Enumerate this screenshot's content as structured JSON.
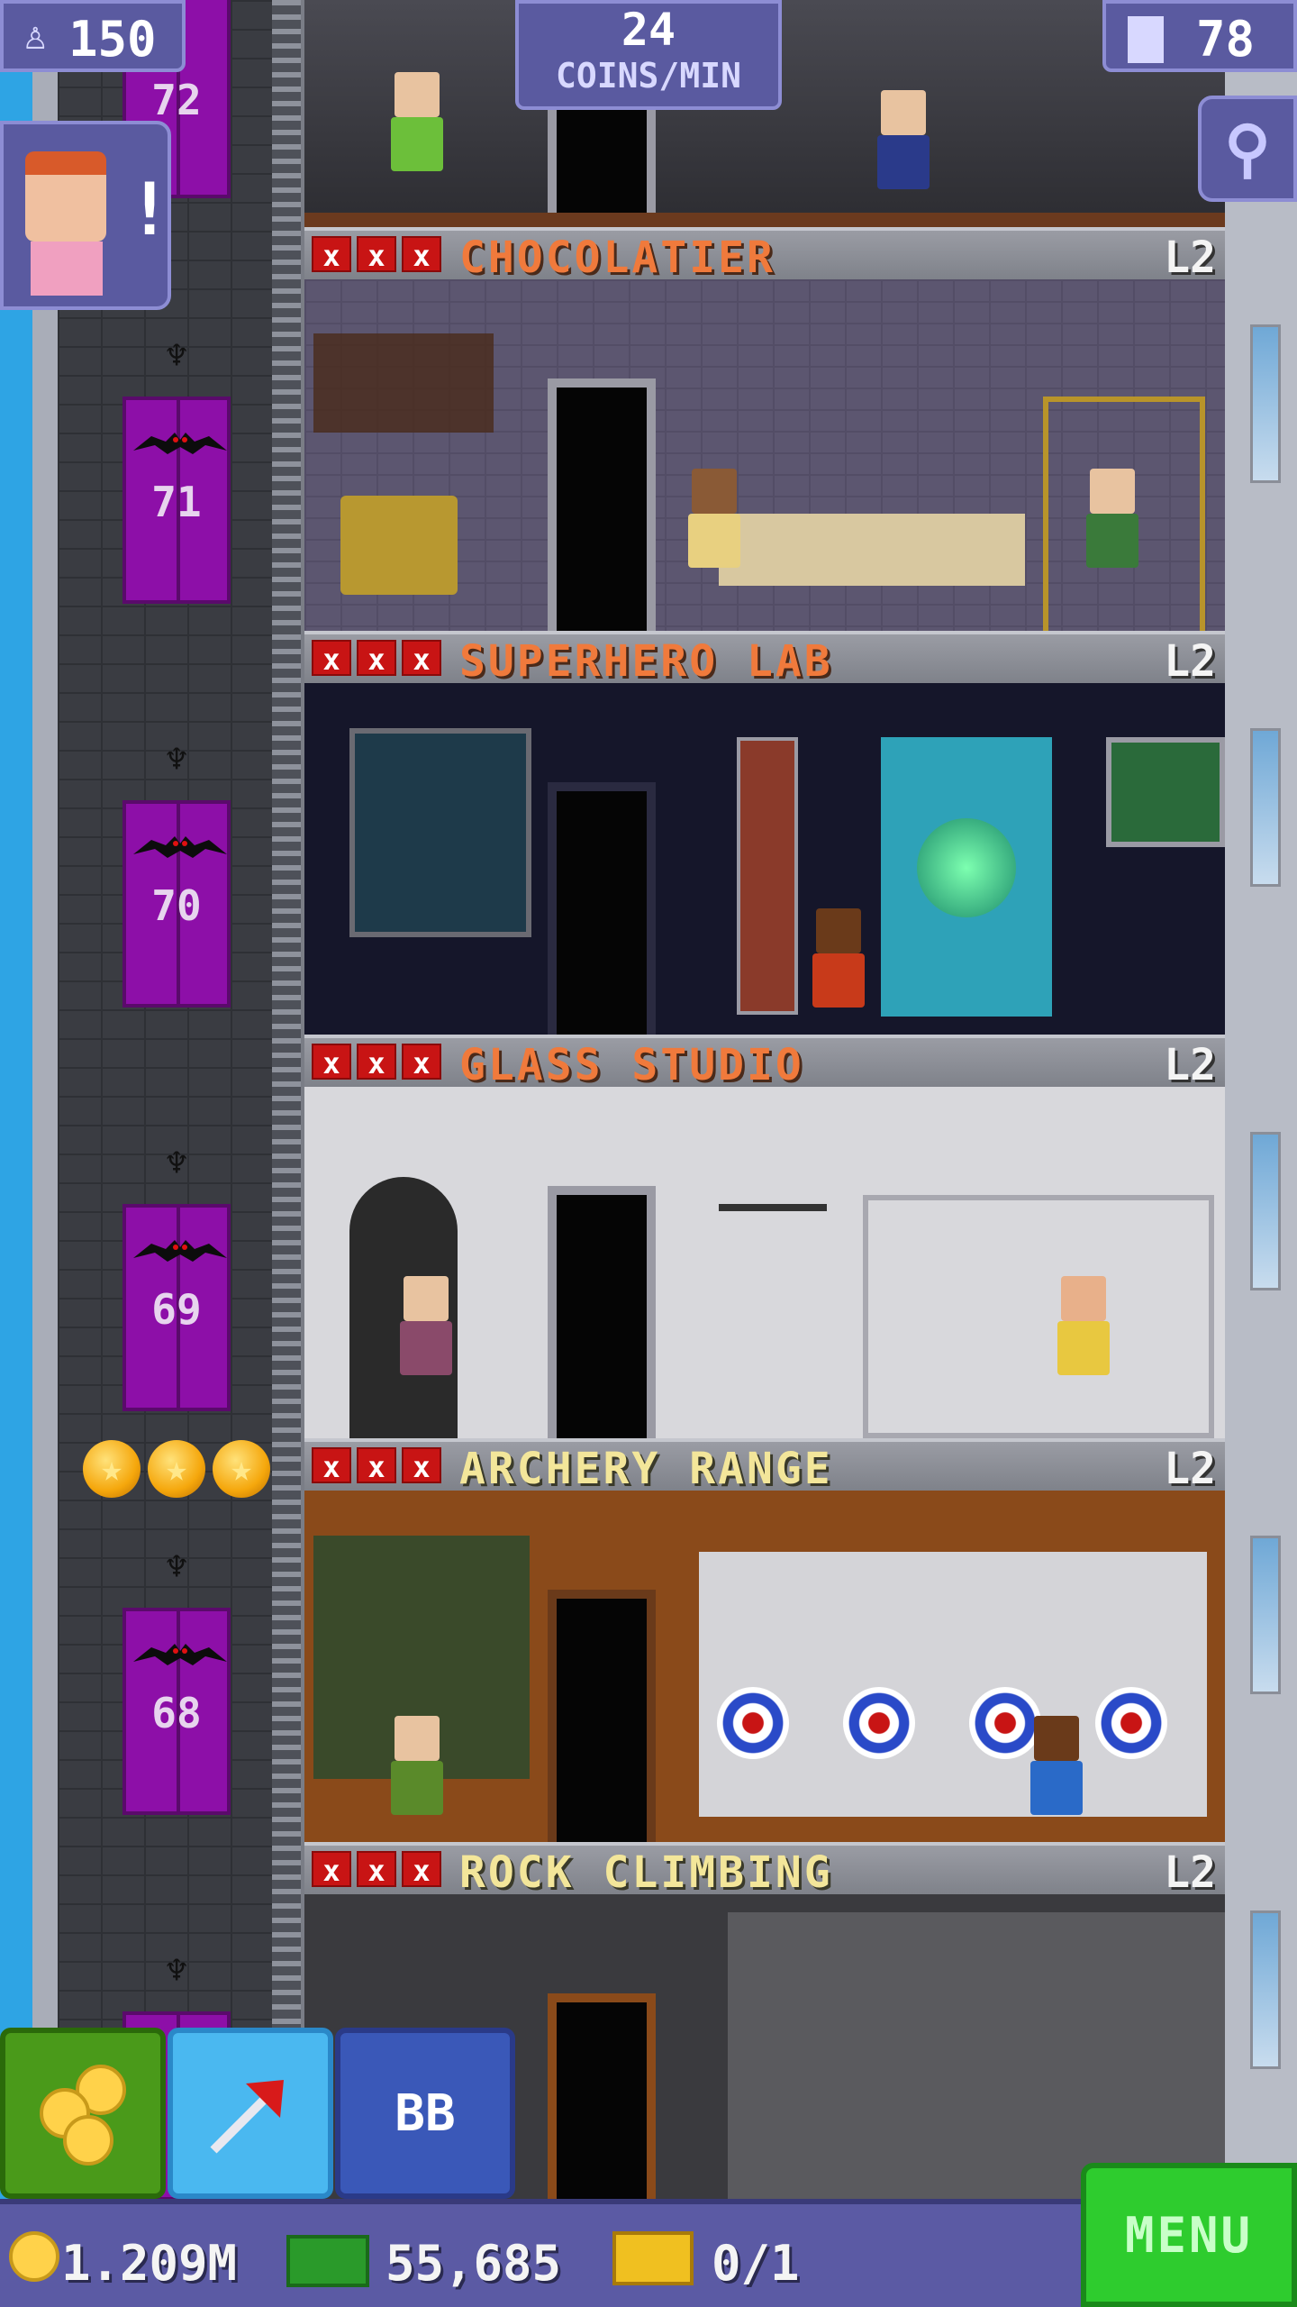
{
  "hud": {
    "population": "150",
    "coins_rate_value": "24",
    "coins_rate_unit": "COINS/MIN",
    "floors_count": "78"
  },
  "notification": {
    "badge": "!"
  },
  "elevator_floors": [
    {
      "number": "72"
    },
    {
      "number": "71"
    },
    {
      "number": "70"
    },
    {
      "number": "69"
    },
    {
      "number": "68"
    }
  ],
  "floors": [
    {
      "name": "CHOCOLATIER",
      "level": "L2",
      "stocked": [
        "x",
        "x",
        "x"
      ]
    },
    {
      "name": "SUPERHERO LAB",
      "level": "L2",
      "stocked": [
        "x",
        "x",
        "x"
      ]
    },
    {
      "name": "GLASS STUDIO",
      "level": "L2",
      "stocked": [
        "x",
        "x",
        "x"
      ]
    },
    {
      "name": "ARCHERY RANGE",
      "level": "L2",
      "stocked": [
        "x",
        "x",
        "x"
      ]
    },
    {
      "name": "ROCK CLIMBING",
      "level": "L2",
      "stocked": [
        "x",
        "x",
        "x"
      ]
    }
  ],
  "toolbar": {
    "bitbook_label": "BB"
  },
  "bottom": {
    "coins": "1.209M",
    "bux": "55,685",
    "vip": "0/1",
    "menu_label": "MENU"
  },
  "colors": {
    "elevator": "#8d0fa8",
    "menu_green": "#2ecc2e",
    "hud_purple": "#5a5aa0",
    "floor_name_orange": "#f07a3c",
    "floor_name_gold": "#f3e69a"
  }
}
